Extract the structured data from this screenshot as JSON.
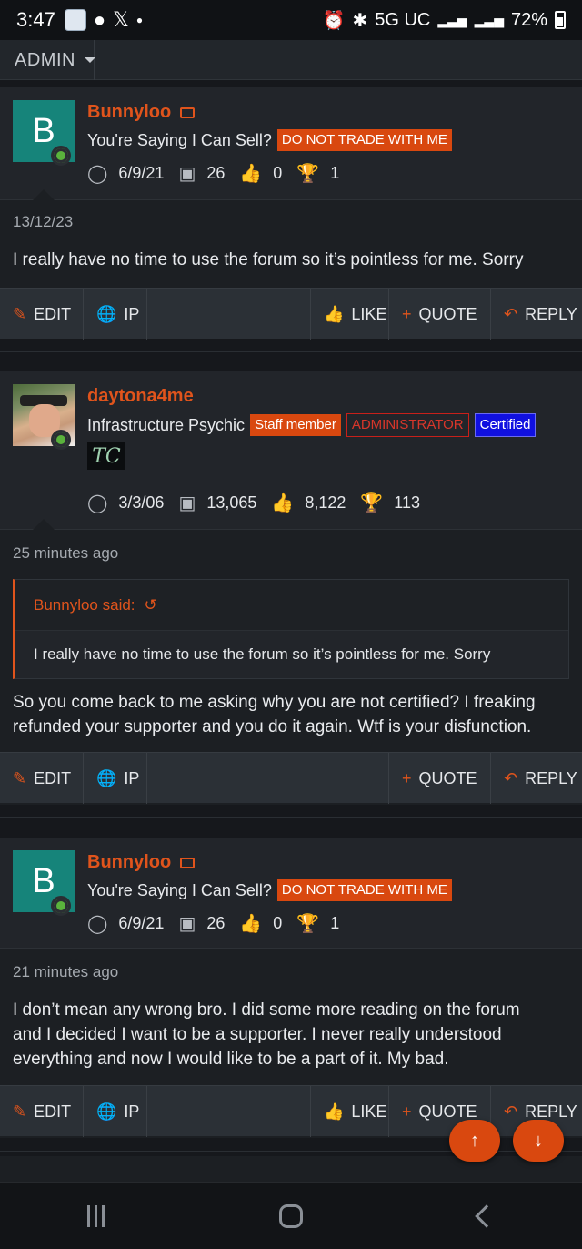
{
  "status": {
    "time": "3:47",
    "network": "5G UC",
    "battery": "72%"
  },
  "adminbar": {
    "label": "ADMIN"
  },
  "posts": [
    {
      "avatar_letter": "B",
      "username": "Bunnyloo",
      "title": "You're Saying I Can Sell?",
      "badges": [
        "DO NOT TRADE WITH ME"
      ],
      "joined": "6/9/21",
      "messages": "26",
      "reactions": "0",
      "points": "1",
      "date": "13/12/23",
      "message": "I really have no time to use the forum so it’s pointless for me. Sorry",
      "actions": {
        "edit": "EDIT",
        "ip": "IP",
        "like": "LIKE",
        "quote": "QUOTE",
        "reply": "REPLY"
      }
    },
    {
      "username": "daytona4me",
      "title": "Infrastructure Psychic",
      "badges": [
        "Staff member",
        "ADMINISTRATOR",
        "Certified"
      ],
      "signature_glyph": "TC",
      "joined": "3/3/06",
      "messages": "13,065",
      "reactions": "8,122",
      "points": "113",
      "date": "25 minutes ago",
      "quote_author": "Bunnyloo said:",
      "quote_text": "I really have no time to use the forum so it’s pointless for me. Sorry",
      "message_lines": [
        "So you come back to me asking why you are not certified? I freaking",
        "refunded your supporter and you do it again. Wtf is your disfunction."
      ],
      "actions": {
        "edit": "EDIT",
        "ip": "IP",
        "quote": "QUOTE",
        "reply": "REPLY"
      }
    },
    {
      "avatar_letter": "B",
      "username": "Bunnyloo",
      "title": "You're Saying I Can Sell?",
      "badges": [
        "DO NOT TRADE WITH ME"
      ],
      "joined": "6/9/21",
      "messages": "26",
      "reactions": "0",
      "points": "1",
      "date": "21 minutes ago",
      "message_lines": [
        "I don’t mean any wrong bro. I did some more reading on the forum",
        "and I decided I want to be a supporter. I never really understood",
        "everything and now I would like to be a part of it. My bad."
      ],
      "actions": {
        "edit": "EDIT",
        "ip": "IP",
        "like": "LIKE",
        "quote": "QUOTE",
        "reply": "REPLY"
      }
    }
  ],
  "colors": {
    "accent": "#e0541c",
    "certified": "#1010e0",
    "avatar_teal": "#16847a"
  }
}
